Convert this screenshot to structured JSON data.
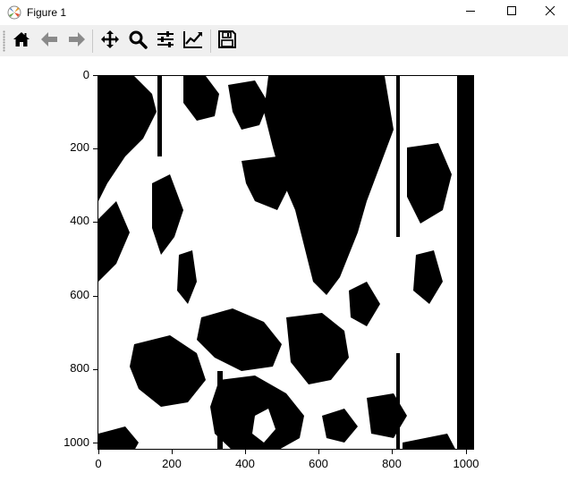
{
  "window": {
    "title": "Figure 1",
    "app_icon": "matplotlib-icon",
    "controls": [
      "minimize-icon",
      "maximize-icon",
      "close-icon"
    ]
  },
  "toolbar": {
    "buttons": [
      "home-icon",
      "back-arrow-icon",
      "forward-arrow-icon",
      "pan-move-icon",
      "zoom-magnifier-icon",
      "configure-subplots-icon",
      "edit-axes-curves-icon",
      "save-floppy-icon"
    ]
  },
  "plot": {
    "type": "image",
    "colormap": "binary (black and white)",
    "x_ticks": [
      "0",
      "200",
      "400",
      "600",
      "800",
      "1000"
    ],
    "y_ticks": [
      "0",
      "200",
      "400",
      "600",
      "800",
      "1000"
    ],
    "x_range": [
      0,
      1024
    ],
    "y_range": [
      1024,
      0
    ]
  }
}
